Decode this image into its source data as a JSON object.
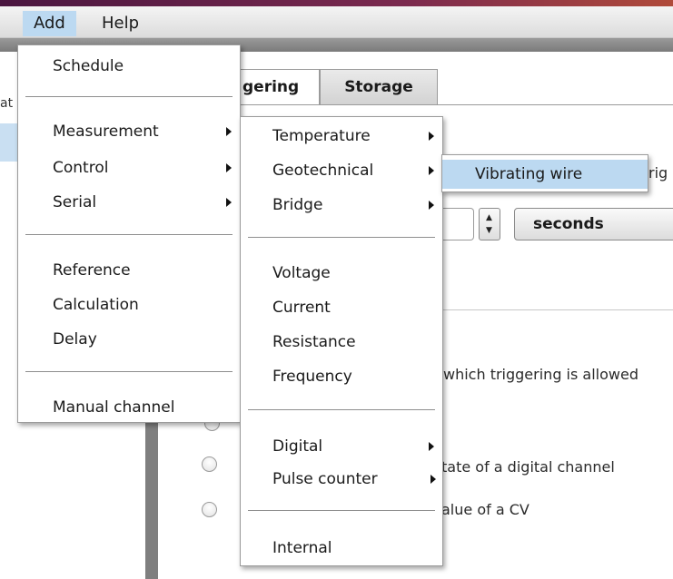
{
  "menubar": {
    "items": [
      "Add",
      "Help"
    ]
  },
  "add_menu": {
    "items": [
      "Schedule",
      "Measurement",
      "Control",
      "Serial",
      "Reference",
      "Calculation",
      "Delay",
      "Manual channel"
    ]
  },
  "measurement_menu": {
    "items": [
      "Temperature",
      "Geotechnical",
      "Bridge",
      "Voltage",
      "Current",
      "Resistance",
      "Frequency",
      "Digital",
      "Pulse counter",
      "Internal"
    ]
  },
  "geotechnical_menu": {
    "items": [
      "Vibrating wire"
    ]
  },
  "background": {
    "left_clip_text": "at",
    "tabs": [
      "gering",
      "Storage"
    ],
    "trigger_clip_text": "rig",
    "units_button": "seconds",
    "triggering_allowed_text": "which triggering is allowed",
    "digital_channel_text": "tate of a digital channel",
    "cv_text": "alue of a CV"
  }
}
